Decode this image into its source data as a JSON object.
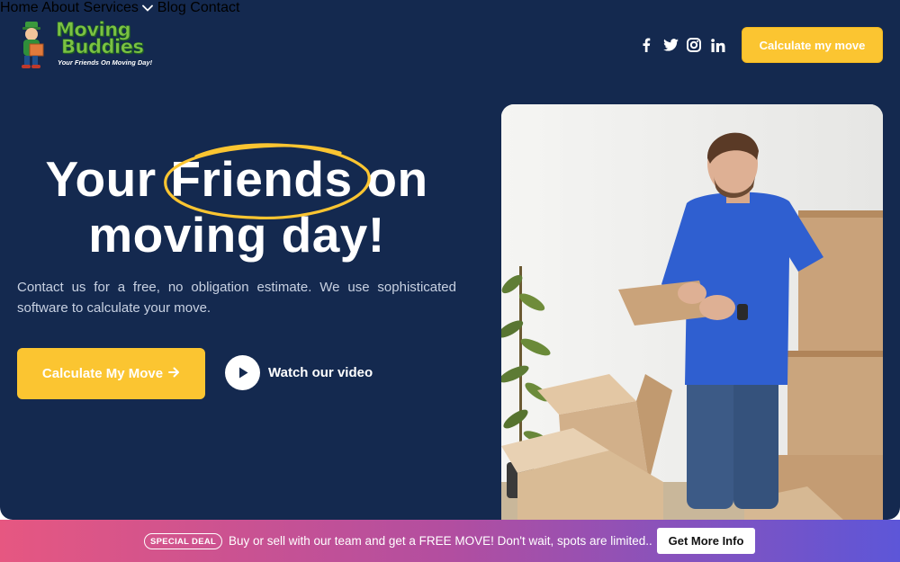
{
  "brand": {
    "name_line1": "Moving",
    "name_line2": "Buddies",
    "tagline": "Your Friends On Moving Day!"
  },
  "nav": {
    "items": [
      {
        "label": "Home"
      },
      {
        "label": "About"
      },
      {
        "label": "Services",
        "has_dropdown": true
      },
      {
        "label": "Blog"
      },
      {
        "label": "Contact"
      }
    ]
  },
  "social": [
    "facebook-icon",
    "twitter-icon",
    "instagram-icon",
    "linkedin-icon"
  ],
  "header_cta": "Calculate my move",
  "hero": {
    "headline_1": "Your",
    "headline_highlight": "Friends",
    "headline_2": "on",
    "headline_line2": "moving day!",
    "lead": "Contact us for a free, no obligation estimate. We use sophisticated software to calculate your move.",
    "cta": "Calculate My Move",
    "video_label": "Watch our video"
  },
  "banner": {
    "pill": "SPECIAL DEAL",
    "text": "Buy or sell with our team and get a FREE MOVE! Don't wait, spots are limited..",
    "button": "Get More Info"
  },
  "colors": {
    "background": "#14294f",
    "accent": "#fbc531",
    "brand_green": "#7bc242",
    "gradient_start": "#e65781",
    "gradient_end": "#5d56d8"
  }
}
